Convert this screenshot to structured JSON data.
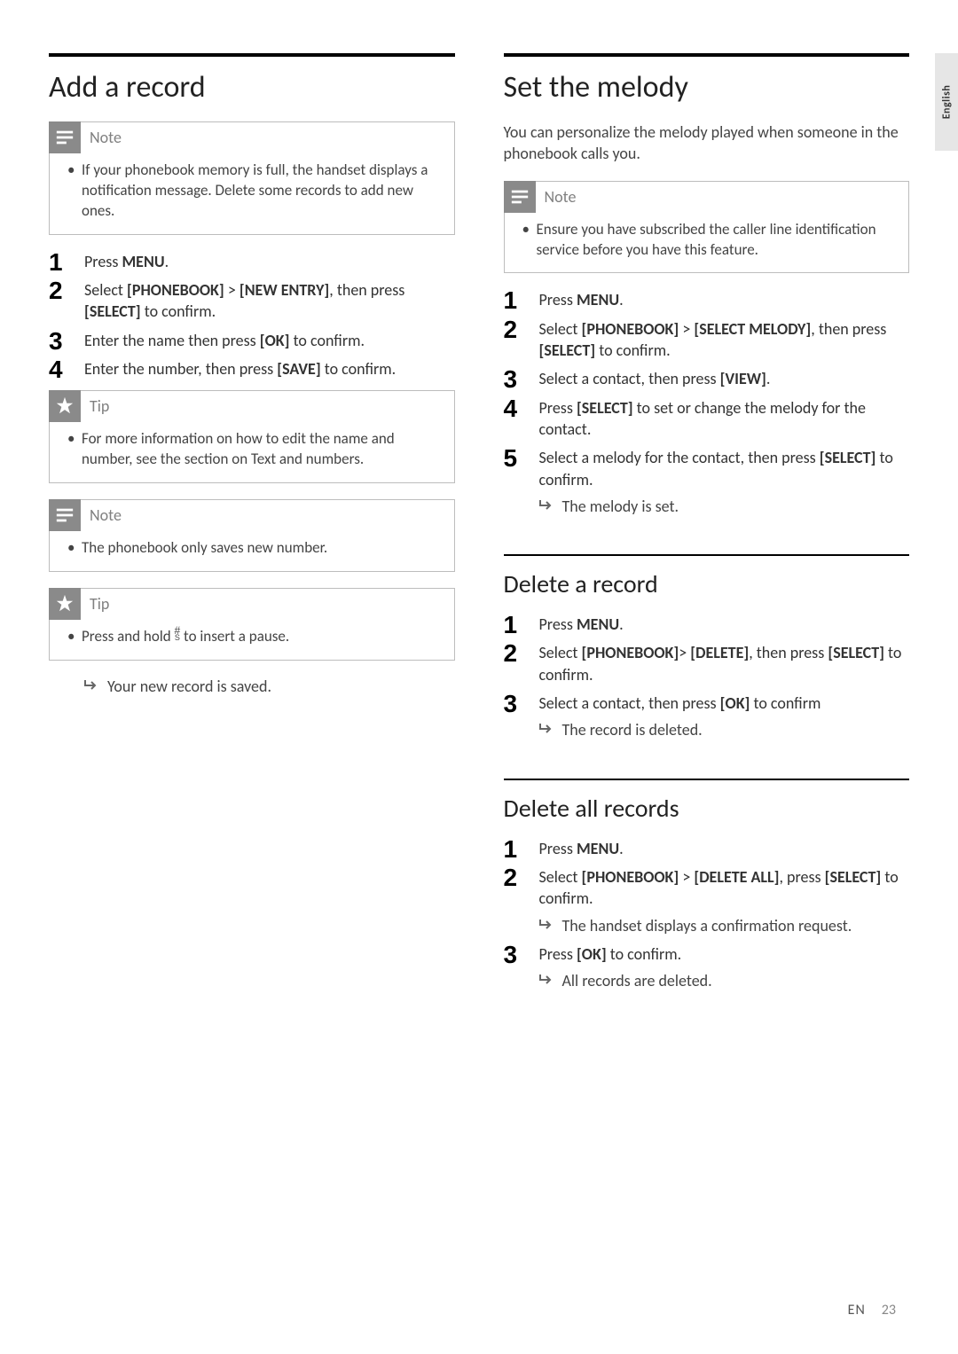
{
  "sideTab": "English",
  "footer": {
    "lang": "EN",
    "page": "23"
  },
  "left": {
    "addRecord": {
      "title": "Add a record",
      "note1": {
        "label": "Note",
        "text": "If your phonebook memory is full, the handset displays a notification message. Delete some records to add new ones."
      },
      "steps": [
        {
          "pre": "Press ",
          "b1": "MENU",
          "post": "."
        },
        {
          "pre": "Select ",
          "b1": "[PHONEBOOK]",
          "mid1": " > ",
          "b2": "[NEW ENTRY]",
          "mid2": ", then press ",
          "b3": "[SELECT]",
          "post": " to confirm."
        },
        {
          "pre": "Enter the name then press ",
          "b1": "[OK]",
          "post": " to confirm."
        },
        {
          "pre": "Enter the number, then press ",
          "b1": "[SAVE]",
          "post": " to confirm."
        }
      ],
      "tip1": {
        "label": "Tip",
        "text": "For more information on how to edit the name and number, see the section on Text and numbers."
      },
      "note2": {
        "label": "Note",
        "text": "The phonebook only saves new number."
      },
      "tip2": {
        "label": "Tip",
        "textPre": "Press and hold ",
        "textPost": " to insert a pause."
      },
      "result": "Your new record is saved."
    }
  },
  "right": {
    "setMelody": {
      "title": "Set the melody",
      "intro": "You can personalize the melody played when someone in the phonebook calls you.",
      "note": {
        "label": "Note",
        "text": "Ensure you have subscribed the caller line identification service before you have this feature."
      },
      "steps": [
        {
          "pre": "Press ",
          "b1": "MENU",
          "post": "."
        },
        {
          "pre": "Select ",
          "b1": "[PHONEBOOK]",
          "mid1": " > ",
          "b2": "[SELECT MELODY]",
          "mid2": ", then press ",
          "b3": "[SELECT]",
          "post": " to confirm."
        },
        {
          "pre": "Select a contact, then press ",
          "b1": "[VIEW]",
          "post": "."
        },
        {
          "pre": "Press ",
          "b1": "[SELECT]",
          "post": " to set or change the melody for the contact."
        },
        {
          "pre": "Select a melody for the contact, then press ",
          "b1": "[SELECT]",
          "post": " to confirm.",
          "result": "The melody is set."
        }
      ]
    },
    "deleteRecord": {
      "title": "Delete a record",
      "steps": [
        {
          "pre": "Press ",
          "b1": "MENU",
          "post": "."
        },
        {
          "pre": "Select ",
          "b1": "[PHONEBOOK]",
          "mid1": "> ",
          "b2": "[DELETE]",
          "mid2": ", then press ",
          "b3": "[SELECT]",
          "post": " to confirm."
        },
        {
          "pre": "Select a contact, then press ",
          "b1": "[OK]",
          "post": " to confirm",
          "result": "The record is deleted."
        }
      ]
    },
    "deleteAll": {
      "title": "Delete all records",
      "steps": [
        {
          "pre": "Press ",
          "b1": "MENU",
          "post": "."
        },
        {
          "pre": "Select ",
          "b1": "[PHONEBOOK]",
          "mid1": " > ",
          "b2": "[DELETE ALL]",
          "mid2": ", press ",
          "b3": "[SELECT]",
          "post": " to confirm.",
          "result": "The handset displays a confirmation request."
        },
        {
          "pre": "Press ",
          "b1": "[OK]",
          "post": " to confirm.",
          "result": "All records are deleted."
        }
      ]
    }
  }
}
